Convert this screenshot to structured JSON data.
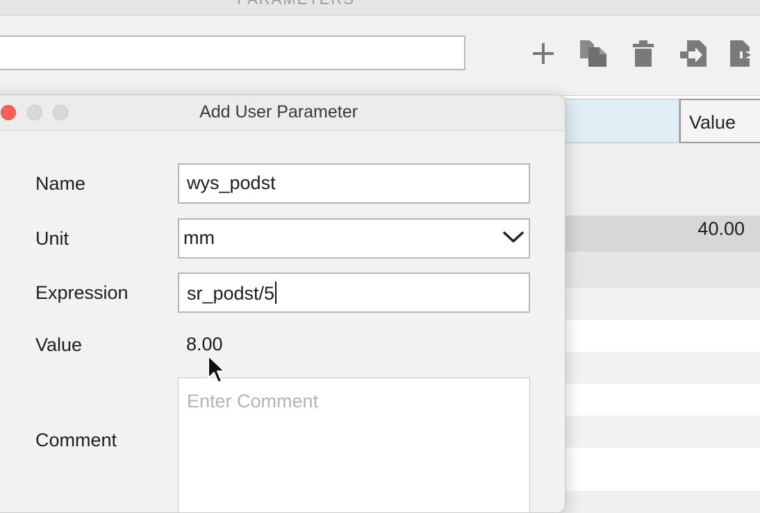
{
  "window": {
    "title": "PARAMETERS"
  },
  "toolbar": {
    "search_value": "",
    "icons": [
      "add-icon",
      "copy-icon",
      "delete-icon",
      "import-icon",
      "export-icon"
    ]
  },
  "table": {
    "columns": [
      "Value"
    ],
    "selected_row_value": "40.00"
  },
  "dialog": {
    "title": "Add User Parameter",
    "name_label": "Name",
    "name_value": "wys_podst",
    "unit_label": "Unit",
    "unit_value": "mm",
    "expression_label": "Expression",
    "expression_value": "sr_podst/5",
    "value_label": "Value",
    "value_display": "8.00",
    "comment_label": "Comment",
    "comment_placeholder": "Enter Comment"
  },
  "colors": {
    "close_button": "#fc5f57",
    "header_highlight": "#dfeef5",
    "selected_row": "#d7d7d7"
  }
}
